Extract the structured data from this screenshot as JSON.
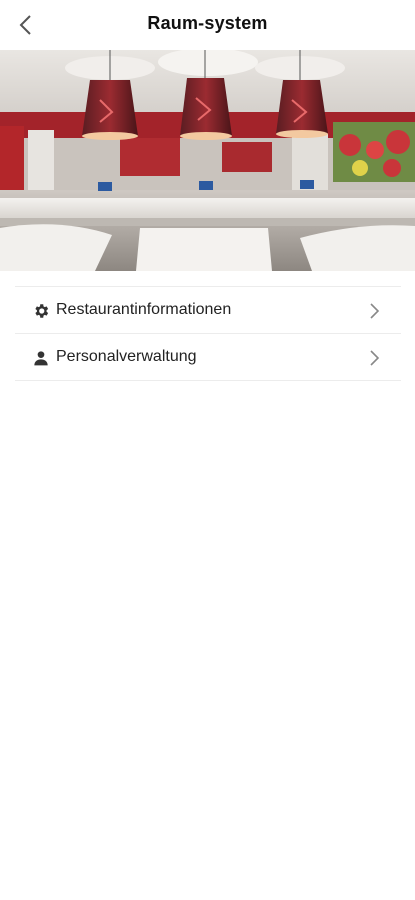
{
  "header": {
    "title": "Raum-system",
    "back_icon": "chevron-left-icon"
  },
  "hero": {
    "image_subject": "restaurant-interior-photo"
  },
  "menu": {
    "items": [
      {
        "label": "Restaurantinformationen",
        "icon": "gear-icon"
      },
      {
        "label": "Personalverwaltung",
        "icon": "person-icon"
      }
    ]
  },
  "colors": {
    "accent_red": "#b3262a",
    "divider": "#ececec",
    "text": "#222222"
  }
}
